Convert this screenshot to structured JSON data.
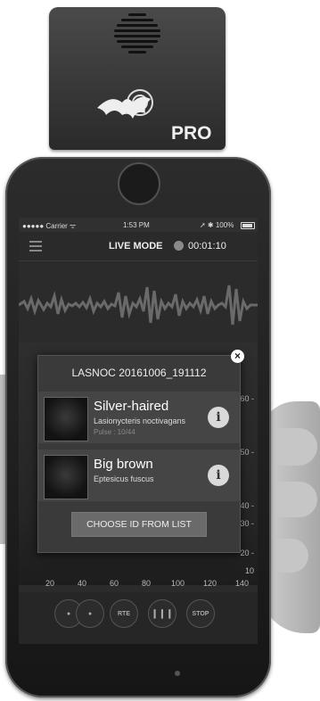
{
  "device": {
    "badge": "PRO"
  },
  "status_bar": {
    "carrier": "●●●●● Carrier ᯤ",
    "time": "1:53 PM",
    "battery": "➚ ✱ 100%"
  },
  "header": {
    "mode_label": "LIVE MODE",
    "timer": "00:01:10"
  },
  "spectrogram": {
    "y_ticks": [
      "60 -",
      "50 -",
      "40 -",
      "30 -",
      "20 -",
      "10"
    ],
    "x_ticks": [
      "20",
      "40",
      "60",
      "80",
      "100",
      "120",
      "140"
    ]
  },
  "dialog": {
    "title_prefix": "LASNOC",
    "title_id": "20161006_191112",
    "close_label": "×",
    "results": [
      {
        "name": "Silver-haired",
        "scientific": "Lasionycteris noctivagans",
        "pulse": "Pulse : 10/44",
        "info_label": "i"
      },
      {
        "name": "Big brown",
        "scientific": "Eptesicus fuscus",
        "pulse": "",
        "info_label": "i"
      }
    ],
    "choose_label": "CHOOSE ID FROM LIST"
  },
  "controls": {
    "rte_label": "RTE",
    "stop_label": "STOP"
  }
}
